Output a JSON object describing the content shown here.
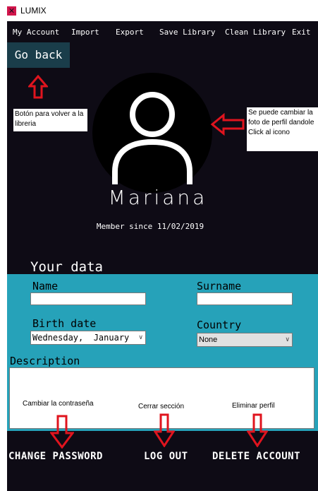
{
  "window": {
    "title": "LUMIX"
  },
  "menu": [
    "My Account",
    "Import",
    "Export",
    "Save Library",
    "Clean Library",
    "Exit"
  ],
  "go_back_label": "Go back",
  "notes": {
    "go_back": "Botón para volver a la libreria",
    "avatar": "Se puede cambiar la foto de perfil dandole Click al icono",
    "change_password": "Cambiar la contraseña",
    "logout": "Cerrar sección",
    "delete": "Eliminar perfil"
  },
  "profile": {
    "username": "Mariana",
    "member_since": "Member since 11/02/2019"
  },
  "form": {
    "section_title": "Your data",
    "name_label": "Name",
    "name_value": "",
    "surname_label": "Surname",
    "surname_value": "",
    "birth_label": "Birth date",
    "birth_value": "Wednesday,  January",
    "country_label": "Country",
    "country_value": "None",
    "description_label": "Description",
    "description_value": ""
  },
  "buttons": {
    "change_password": "CHANGE PASSWORD",
    "logout": "LOG OUT",
    "delete_account": "DELETE ACCOUNT"
  },
  "colors": {
    "background": "#0e0b15",
    "panel": "#26a2b9",
    "go_back_bg": "#1a3d4a",
    "annotation_arrow": "#e0141e",
    "logo": "#d1154b"
  }
}
